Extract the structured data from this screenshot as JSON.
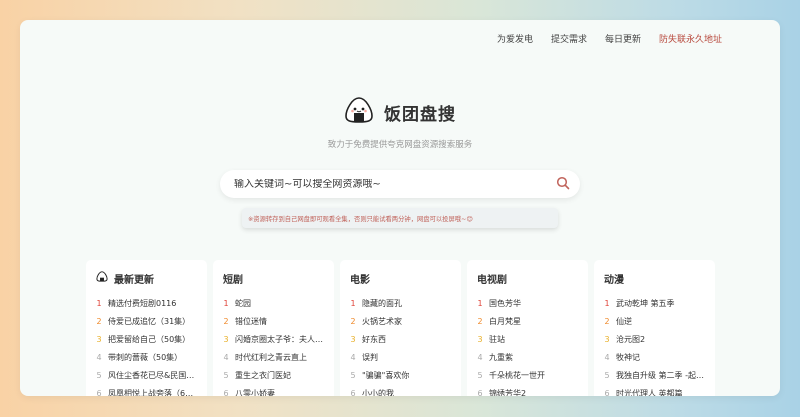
{
  "nav": {
    "items": [
      {
        "label": "为爱发电",
        "highlight": false
      },
      {
        "label": "提交需求",
        "highlight": false
      },
      {
        "label": "每日更新",
        "highlight": false
      },
      {
        "label": "防失联永久地址",
        "highlight": true
      }
    ]
  },
  "brand": {
    "title": "饭团盘搜",
    "icon": "onigiri-logo-icon"
  },
  "subtitle": "致力于免费提供夸克网盘资源搜索服务",
  "search": {
    "placeholder": "输入关键词~可以搜全网资源哦~",
    "icon": "search-icon"
  },
  "notice": "※资源转存到自己网盘即可观看全集，否则只能试看两分钟，网盘可以投屏哦~😊",
  "columns": [
    {
      "title": "最新更新",
      "icon": "onigiri-icon",
      "items": [
        "精选付费短剧0116",
        "侍爱已成追忆（31集）",
        "把爱留给自己（50集）",
        "带刺的蔷薇（50集）",
        "风住尘香花已尽&民国深...",
        "凤凰相悦上战旁落（60..."
      ]
    },
    {
      "title": "短剧",
      "items": [
        "蛇园",
        "错位迷情",
        "闪婚京圈太子爷：夫人她...",
        "时代红利之青云直上",
        "重生之衣门医妃",
        "八零小娇妻"
      ]
    },
    {
      "title": "电影",
      "items": [
        "隐藏的面孔",
        "火锅艺术家",
        "好东西",
        "误判",
        "\"骗骗\"喜欢你",
        "小小的我"
      ]
    },
    {
      "title": "电视剧",
      "items": [
        "国色芳华",
        "白月梵星",
        "驻站",
        "九重紫",
        "千朵桃花一世开",
        "锦绣芳华2"
      ]
    },
    {
      "title": "动漫",
      "items": [
        "武动乾坤 第五季",
        "仙逆",
        "沧元图2",
        "牧神记",
        "我独自升级 第二季 -起于...",
        "时光代理人 英都篇"
      ]
    }
  ],
  "colors": {
    "rank1": "#e0463b",
    "rank2": "#ef8a2b",
    "rank3": "#e8b02a",
    "highlight": "#b84a3e"
  }
}
